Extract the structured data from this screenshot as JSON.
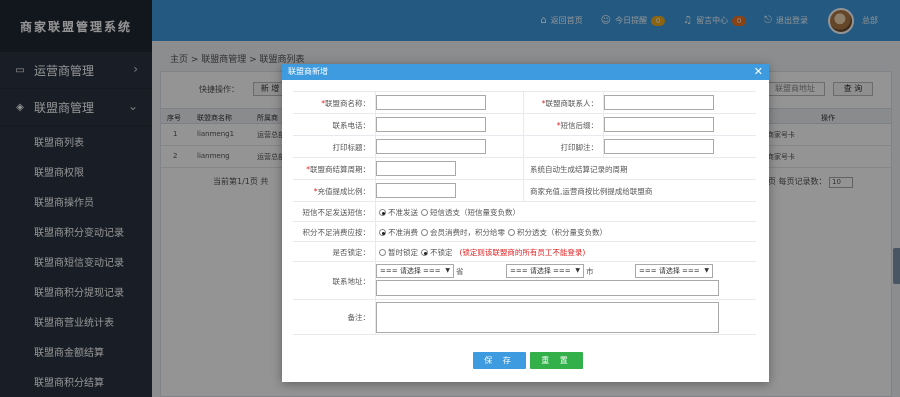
{
  "app": {
    "logo_text": "商家联盟管理系统"
  },
  "topbar": {
    "home": "返回首页",
    "today_remind": "今日提醒",
    "today_count": "0",
    "message_center": "留言中心",
    "message_count": "0",
    "logout": "退出登录",
    "user": "总部"
  },
  "sidebar": {
    "group_operator": "运营商管理",
    "group_alliance": "联盟商管理",
    "items": [
      "联盟商列表",
      "联盟商权限",
      "联盟商操作员",
      "联盟商积分变动记录",
      "联盟商短信变动记录",
      "联盟商积分提现记录",
      "联盟商营业统计表",
      "联盟商金额结算",
      "联盟商积分结算"
    ]
  },
  "background": {
    "breadcrumb": "主页 > 联盟商管理 > 联盟商列表",
    "quick_ops": "快捷操作：",
    "new_btn": "新 增",
    "query_btn": "查 询",
    "filter_right": "联盟商地址",
    "headers": [
      "序号",
      "联盟商名称",
      "所属商",
      "操作"
    ],
    "rows": [
      {
        "no": "1",
        "name": "lianmeng1",
        "owner": "运营总部",
        "op": "商家号卡"
      },
      {
        "no": "2",
        "name": "lianmeng",
        "owner": "运营总部",
        "op": "商家号卡"
      }
    ],
    "pager_left": "当前第1/1页  共",
    "pager_right": "页  每页记录数：",
    "page_size": "10"
  },
  "modal": {
    "title": "联盟商新增",
    "close": "✕",
    "fields": {
      "name_label": "联盟商名称：",
      "contact_label": "联盟商联系人：",
      "phone_label": "联系电话：",
      "sms_suffix_label": "短信后缀：",
      "print_header_label": "打印标题：",
      "print_footer_label": "打印脚注：",
      "settle_cycle_label": "联盟商结算周期：",
      "settle_cycle_hint": "系统自动生成结算记录的周期",
      "recharge_ratio_label": "充值提成比例：",
      "recharge_ratio_hint": "商家充值,运营商按比例提成给联盟商",
      "sms_insufficient_label": "短信不足发送短信：",
      "sms_options": [
        "不准发送",
        "短信透支（短信量变负数）"
      ],
      "points_insufficient_label": "积分不足消费应按：",
      "points_options": [
        "不准消费",
        "会员消费时，积分给零",
        "积分透支（积分量变负数）"
      ],
      "lock_label": "是否锁定：",
      "lock_options": [
        "暂时锁定",
        "不锁定"
      ],
      "lock_hint": "(锁定则该联盟商的所有员工不能登录)",
      "address_label": "联系地址：",
      "province_select": "=== 请选择 ===",
      "province_suffix": "省",
      "city_select": "=== 请选择 ===",
      "city_suffix": "市",
      "district_select": "=== 请选择 ===",
      "remark_label": "备注："
    },
    "save_btn": "保 存",
    "reset_btn": "重 置"
  }
}
